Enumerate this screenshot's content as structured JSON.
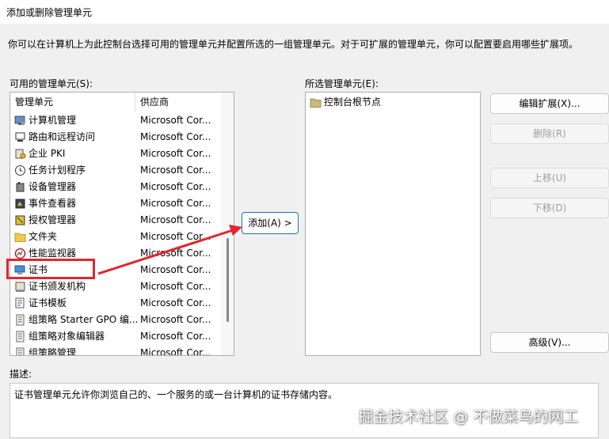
{
  "window": {
    "title": "添加或删除管理单元"
  },
  "description": "你可以在计算机上为此控制台选择可用的管理单元并配置所选的一组管理单元。对于可扩展的管理单元，你可以配置要启用哪些扩展项。",
  "available": {
    "label": "可用的管理单元(S):",
    "col_name": "管理单元",
    "col_vendor": "供应商",
    "items": [
      {
        "name": "计算机管理",
        "vendor": "Microsoft Cor...",
        "icon": "computer-management-icon"
      },
      {
        "name": "路由和远程访问",
        "vendor": "Microsoft Cor...",
        "icon": "routing-icon"
      },
      {
        "name": "企业 PKI",
        "vendor": "Microsoft Cor...",
        "icon": "pki-icon"
      },
      {
        "name": "任务计划程序",
        "vendor": "Microsoft Cor...",
        "icon": "clock-icon"
      },
      {
        "name": "设备管理器",
        "vendor": "Microsoft Cor...",
        "icon": "device-manager-icon"
      },
      {
        "name": "事件查看器",
        "vendor": "Microsoft Cor...",
        "icon": "event-viewer-icon"
      },
      {
        "name": "授权管理器",
        "vendor": "Microsoft Cor...",
        "icon": "authorization-icon"
      },
      {
        "name": "文件夹",
        "vendor": "Microsoft Cor...",
        "icon": "folder-icon"
      },
      {
        "name": "性能监视器",
        "vendor": "Microsoft Cor...",
        "icon": "performance-icon"
      },
      {
        "name": "证书",
        "vendor": "Microsoft Cor...",
        "icon": "certificate-icon"
      },
      {
        "name": "证书颁发机构",
        "vendor": "Microsoft Cor...",
        "icon": "certificate-authority-icon"
      },
      {
        "name": "证书模板",
        "vendor": "Microsoft Cor...",
        "icon": "certificate-template-icon"
      },
      {
        "name": "组策略 Starter GPO 编...",
        "vendor": "Microsoft Cor...",
        "icon": "policy-icon"
      },
      {
        "name": "组策略对象编辑器",
        "vendor": "Microsoft Cor...",
        "icon": "policy-icon"
      },
      {
        "name": "组策略管理",
        "vendor": "Microsoft Cor...",
        "icon": "policy-icon"
      }
    ]
  },
  "add_button": "添加(A) >",
  "selected": {
    "label": "所选管理单元(E):",
    "items": [
      {
        "name": "控制台根节点",
        "icon": "folder-icon"
      }
    ]
  },
  "buttons": {
    "edit_extensions": "编辑扩展(X)...",
    "remove": "删除(R)",
    "move_up": "上移(U)",
    "move_down": "下移(D)",
    "advanced": "高级(V)..."
  },
  "desc_section": {
    "label": "描述:",
    "text": "证书管理单元允许你浏览自己的、一个服务的或一台计算机的证书存储内容。"
  },
  "watermark": "掘金技术社区 @ 不做菜鸟的网工",
  "colors": {
    "highlight_red": "#e0262e",
    "add_button_border": "#1a6fbf"
  }
}
